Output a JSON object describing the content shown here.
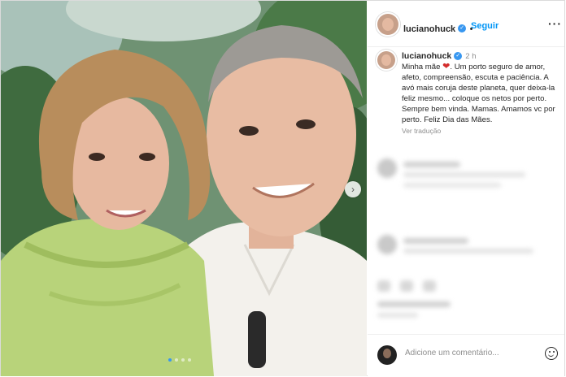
{
  "post": {
    "username": "lucianohuck",
    "follow_label": "Seguir",
    "more_label": "···",
    "time_ago": "2 h",
    "separator": "•",
    "caption_before_heart": "Minha mãe",
    "heart": "❤",
    "caption_after_heart": ". Um porto seguro de amor, afeto, compreensão, escuta e paciência. A avó mais coruja deste planeta, quer deixa-la feliz mesmo... coloque os netos por perto. Sempre bem vinda. Mamas. Amamos vc por perto. Feliz Dia das Mães.",
    "translate_label": "Ver tradução"
  },
  "carousel": {
    "next_label": "›",
    "total_slides": 4,
    "active_slide": 1
  },
  "comment_box": {
    "placeholder": "Adicione um comentário..."
  },
  "icons": {
    "verified": "verified-badge-icon",
    "emoji": "emoji-icon",
    "next": "chevron-right-icon"
  },
  "colors": {
    "link": "#0095f6",
    "verified": "#3897f0",
    "heart": "#d32c2c",
    "muted": "#8e8e8e"
  }
}
